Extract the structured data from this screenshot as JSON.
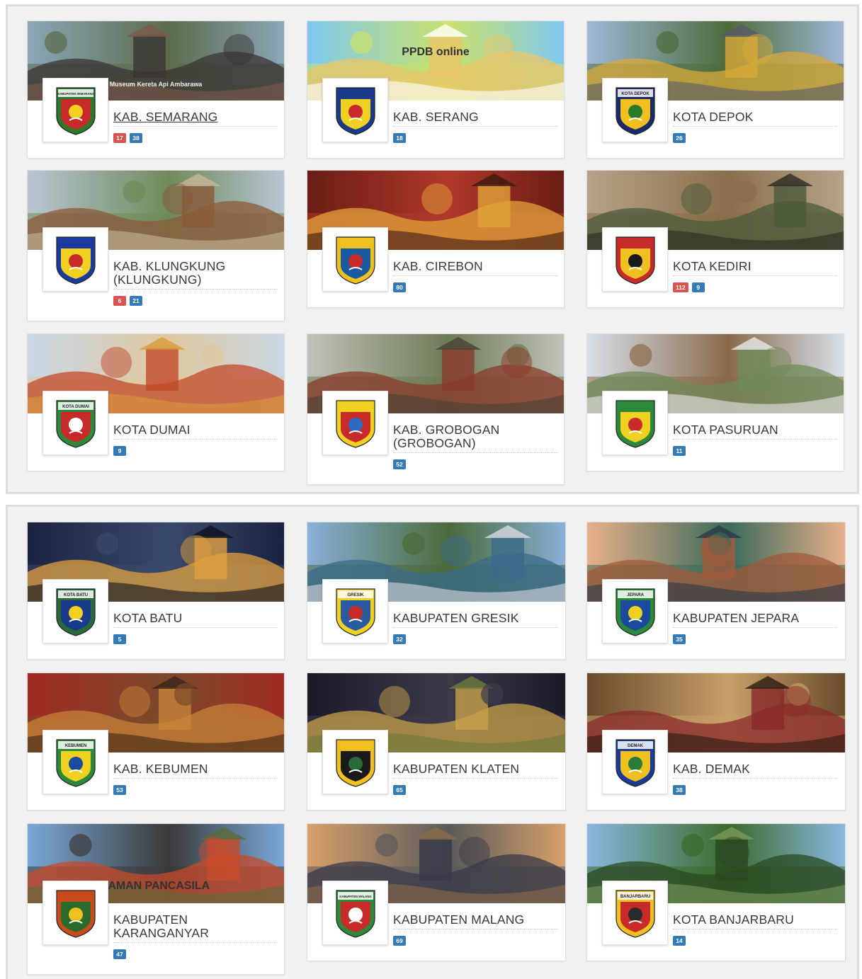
{
  "colors": {
    "badge_red": "#d9534f",
    "badge_blue": "#337ab7",
    "panel_bg": "#f1f1f1",
    "title_text": "#3a3a3a"
  },
  "panels": [
    {
      "cards": [
        {
          "name": "KAB. SEMARANG",
          "badges": [
            {
              "value": "17",
              "color": "red"
            },
            {
              "value": "38",
              "color": "blue"
            }
          ],
          "banner_caption": "Museum Kereta Api Ambarawa",
          "logo_label": "KABUPATEN SEMARANG"
        },
        {
          "name": "KAB. SERANG",
          "badges": [
            {
              "value": "18",
              "color": "blue"
            }
          ],
          "banner_caption": "PPDB online",
          "logo_label": ""
        },
        {
          "name": "KOTA DEPOK",
          "badges": [
            {
              "value": "26",
              "color": "blue"
            }
          ],
          "banner_caption": "",
          "logo_label": "KOTA DEPOK"
        },
        {
          "name": "KAB. KLUNGKUNG (KLUNGKUNG)",
          "badges": [
            {
              "value": "6",
              "color": "red"
            },
            {
              "value": "21",
              "color": "blue"
            }
          ],
          "banner_caption": "",
          "logo_label": ""
        },
        {
          "name": "KAB. CIREBON",
          "badges": [
            {
              "value": "80",
              "color": "blue"
            }
          ],
          "banner_caption": "",
          "logo_label": ""
        },
        {
          "name": "KOTA KEDIRI",
          "badges": [
            {
              "value": "112",
              "color": "red"
            },
            {
              "value": "9",
              "color": "blue"
            }
          ],
          "banner_caption": "",
          "logo_label": ""
        },
        {
          "name": "KOTA DUMAI",
          "badges": [
            {
              "value": "9",
              "color": "blue"
            }
          ],
          "banner_caption": "",
          "logo_label": "KOTA DUMAI"
        },
        {
          "name": "KAB. GROBOGAN (GROBOGAN)",
          "badges": [
            {
              "value": "52",
              "color": "blue"
            }
          ],
          "banner_caption": "",
          "logo_label": ""
        },
        {
          "name": "KOTA PASURUAN",
          "badges": [
            {
              "value": "11",
              "color": "blue"
            }
          ],
          "banner_caption": "",
          "logo_label": ""
        }
      ]
    },
    {
      "cards": [
        {
          "name": "KOTA BATU",
          "badges": [
            {
              "value": "5",
              "color": "blue"
            }
          ],
          "banner_caption": "",
          "logo_label": "KOTA BATU"
        },
        {
          "name": "KABUPATEN GRESIK",
          "badges": [
            {
              "value": "32",
              "color": "blue"
            }
          ],
          "banner_caption": "",
          "logo_label": "GRESIK"
        },
        {
          "name": "KABUPATEN JEPARA",
          "badges": [
            {
              "value": "35",
              "color": "blue"
            }
          ],
          "banner_caption": "",
          "logo_label": "JEPARA"
        },
        {
          "name": "KAB. KEBUMEN",
          "badges": [
            {
              "value": "53",
              "color": "blue"
            }
          ],
          "banner_caption": "",
          "logo_label": "KEBUMEN"
        },
        {
          "name": "KABUPATEN KLATEN",
          "badges": [
            {
              "value": "65",
              "color": "blue"
            }
          ],
          "banner_caption": "",
          "logo_label": ""
        },
        {
          "name": "KAB. DEMAK",
          "badges": [
            {
              "value": "38",
              "color": "blue"
            }
          ],
          "banner_caption": "",
          "logo_label": "DEMAK"
        },
        {
          "name": "KABUPATEN KARANGANYAR",
          "badges": [
            {
              "value": "47",
              "color": "blue"
            }
          ],
          "banner_caption": "TAMAN PANCASILA",
          "logo_label": ""
        },
        {
          "name": "KABUPATEN MALANG",
          "badges": [
            {
              "value": "69",
              "color": "blue"
            }
          ],
          "banner_caption": "",
          "logo_label": "KABUPATEN MALANG"
        },
        {
          "name": "KOTA BANJARBARU",
          "badges": [
            {
              "value": "14",
              "color": "blue"
            }
          ],
          "banner_caption": "",
          "logo_label": "BANJARBARU"
        }
      ]
    }
  ]
}
